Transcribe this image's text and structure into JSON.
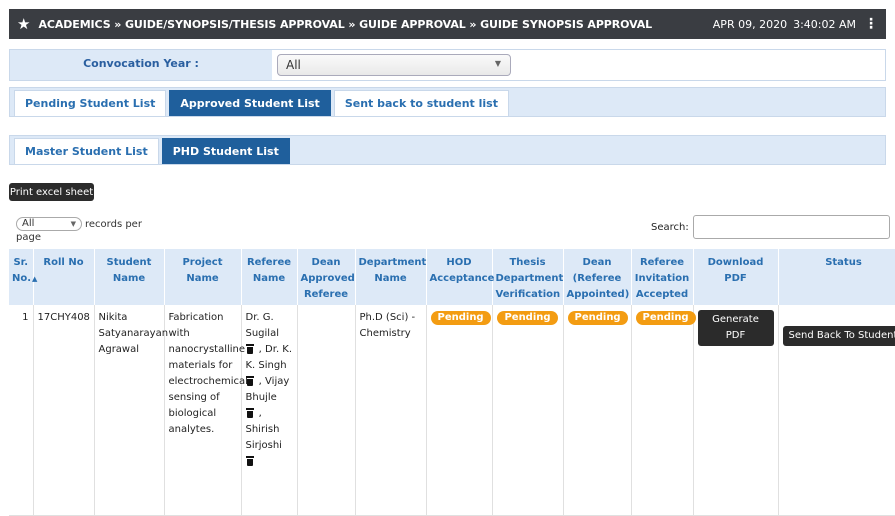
{
  "header": {
    "breadcrumb": "ACADEMICS » GUIDE/SYNOPSIS/THESIS APPROVAL » GUIDE APPROVAL » GUIDE SYNOPSIS APPROVAL",
    "date": "APR 09, 2020",
    "time": "3:40:02 AM"
  },
  "filter": {
    "label": "Convocation Year :",
    "value": "All"
  },
  "tabs_primary": [
    {
      "label": "Pending Student List",
      "active": false
    },
    {
      "label": "Approved Student List",
      "active": true
    },
    {
      "label": "Sent back to student list",
      "active": false
    }
  ],
  "tabs_secondary": [
    {
      "label": "Master Student List",
      "active": false
    },
    {
      "label": "PHD Student List",
      "active": true
    }
  ],
  "toolbar": {
    "print_label": "Print excel sheet",
    "records_value": "All",
    "records_suffix": "records per",
    "records_suffix2": "page",
    "search_label": "Search:"
  },
  "table": {
    "columns": [
      "Sr. No.",
      "Roll No",
      "Student Name",
      "Project Name",
      "Referee Name",
      "Dean Approved Referee",
      "Department Name",
      "HOD Acceptance",
      "Thesis Department Verification",
      "Dean (Referee Appointed)",
      "Referee Invitation Accepted",
      "Download PDF",
      "Status"
    ],
    "rows": [
      {
        "sr": "1",
        "roll": "17CHY408",
        "name": "Nikita Satyanarayan Agrawal",
        "project": "Fabrication with nanocrystalline materials for electrochemical sensing of biological analytes.",
        "referees": [
          "Dr. G. Sugilal",
          "Dr. K. K. Singh",
          "Vijay Bhujle",
          "Shirish Sirjoshi"
        ],
        "dean_approved": "",
        "department": "Ph.D (Sci) - Chemistry",
        "hod": "Pending",
        "thesis": "Pending",
        "dean": "Pending",
        "invitation": "Pending",
        "pdf_button": "Generate PDF",
        "status_button": "Send Back To Student"
      }
    ]
  },
  "colors": {
    "topbar": "#3a3d42",
    "active_tab": "#1f5f9c",
    "header_bg": "#dde9f7",
    "badge": "#f39c12"
  }
}
